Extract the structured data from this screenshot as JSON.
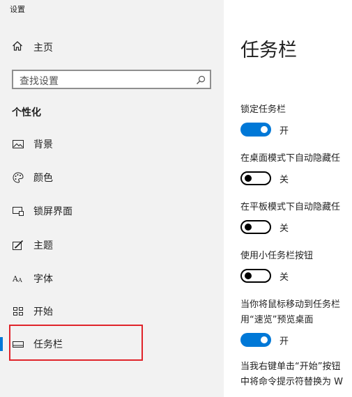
{
  "window_title": "设置",
  "sidebar": {
    "home_label": "主页",
    "search_placeholder": "查找设置",
    "section_title": "个性化",
    "items": [
      {
        "label": "背景"
      },
      {
        "label": "颜色"
      },
      {
        "label": "锁屏界面"
      },
      {
        "label": "主题"
      },
      {
        "label": "字体"
      },
      {
        "label": "开始"
      },
      {
        "label": "任务栏",
        "selected": true
      }
    ]
  },
  "main": {
    "title": "任务栏",
    "settings": [
      {
        "label": "锁定任务栏",
        "state": "on",
        "state_label": "开"
      },
      {
        "label": "在桌面模式下自动隐藏任",
        "state": "off",
        "state_label": "关"
      },
      {
        "label": "在平板模式下自动隐藏任",
        "state": "off",
        "state_label": "关"
      },
      {
        "label": "使用小任务栏按钮",
        "state": "off",
        "state_label": "关"
      },
      {
        "label_line1": "当你将鼠标移动到任务栏",
        "label_line2": "用“速览”预览桌面",
        "state": "on",
        "state_label": "开"
      },
      {
        "label_line1": "当我右键单击“开始”按钮",
        "label_line2": "中将命令提示符替换为 W"
      }
    ]
  },
  "colors": {
    "accent": "#0078d7",
    "sidebar_bg": "#f2f2f2",
    "highlight": "#e0232a"
  }
}
